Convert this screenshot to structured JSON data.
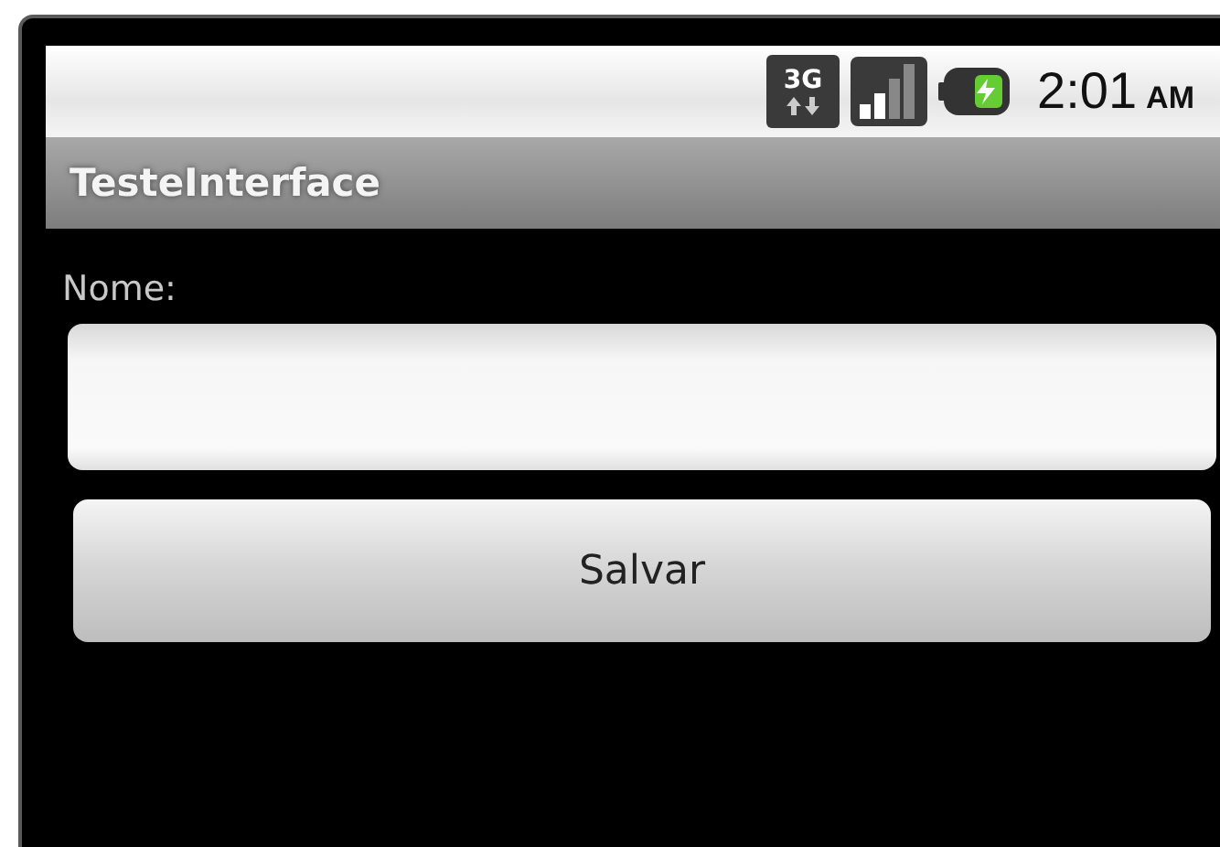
{
  "status_bar": {
    "network_type": "3G",
    "time": "2:01",
    "meridiem": "AM"
  },
  "title_bar": {
    "title": "TesteInterface"
  },
  "form": {
    "label": "Nome:",
    "button": "Salvar"
  }
}
